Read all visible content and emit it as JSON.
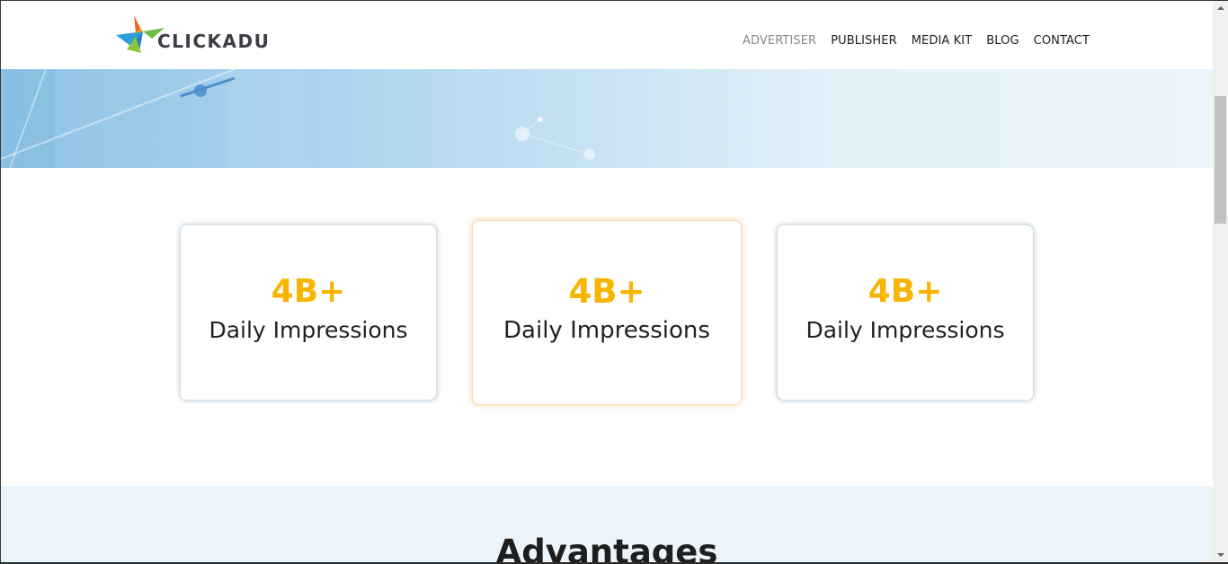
{
  "header": {
    "logo_text": "CLICKADU",
    "nav": [
      {
        "label": "ADVERTISER",
        "active": true
      },
      {
        "label": "PUBLISHER",
        "active": false
      },
      {
        "label": "MEDIA KIT",
        "active": false
      },
      {
        "label": "BLOG",
        "active": false
      },
      {
        "label": "CONTACT",
        "active": false
      }
    ]
  },
  "stats": [
    {
      "value": "4B+",
      "label": "Daily Impressions"
    },
    {
      "value": "4B+",
      "label": "Daily Impressions"
    },
    {
      "value": "4B+",
      "label": "Daily Impressions"
    }
  ],
  "advantages": {
    "title": "Advantages"
  },
  "colors": {
    "accent": "#f7b500",
    "nav_active": "#8a8a8a",
    "section_bg": "#eaf4fa",
    "highlight_glow": "#ffaa5a"
  }
}
